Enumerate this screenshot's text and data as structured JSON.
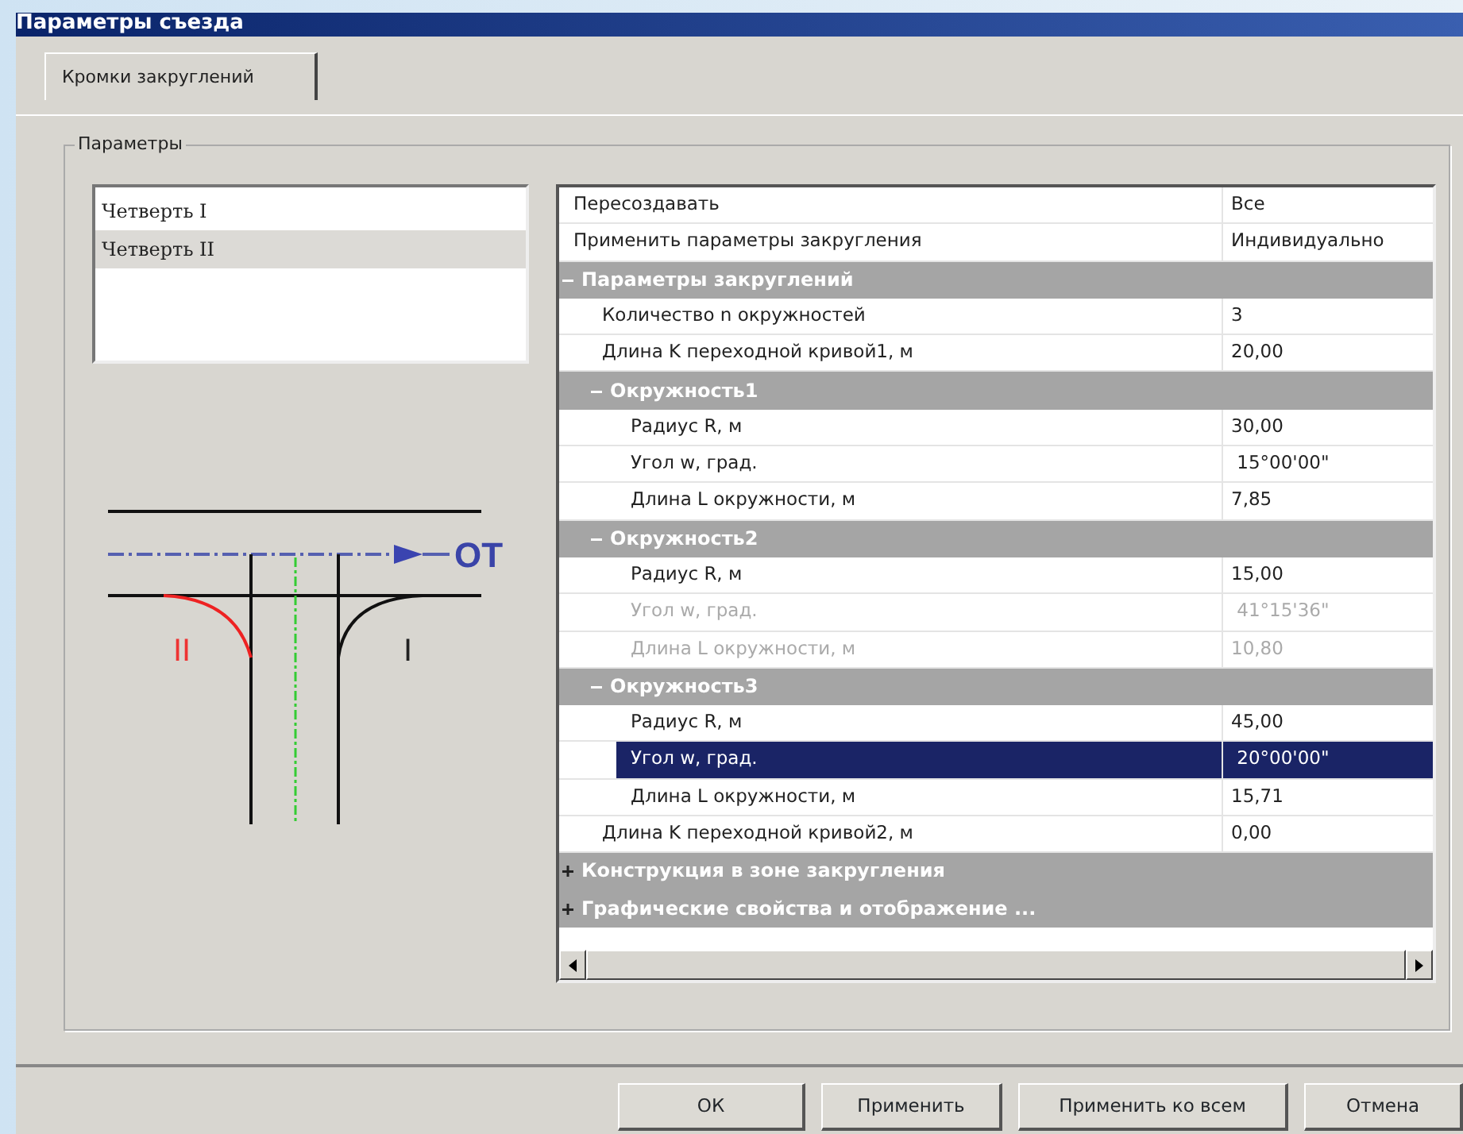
{
  "window": {
    "title": "Параметры съезда"
  },
  "tabs": [
    {
      "label": "Кромки закруглений",
      "selected": true
    }
  ],
  "group": {
    "title": "Параметры"
  },
  "quarters": [
    {
      "label": "Четверть I",
      "selected": false
    },
    {
      "label": "Четверть  II",
      "selected": true
    }
  ],
  "diagram": {
    "axis_label": "ОТ",
    "quarter_labels": [
      "II",
      "I"
    ]
  },
  "grid": [
    {
      "kind": "property",
      "name": "Пересоздавать",
      "value": "Все",
      "disabled": false,
      "selected": false
    },
    {
      "kind": "property",
      "name": "Применить параметры закругления",
      "value": "Индивидуально",
      "disabled": false,
      "selected": false
    },
    {
      "kind": "category",
      "name": "Параметры закруглений",
      "expanded": true,
      "children": [
        {
          "kind": "property",
          "name": "Количество n окружностей",
          "value": "3",
          "disabled": false,
          "selected": false
        },
        {
          "kind": "property",
          "name": "Длина K переходной кривой1, м",
          "value": "20,00",
          "disabled": false,
          "selected": false
        },
        {
          "kind": "category",
          "name": "Окружность1",
          "expanded": true,
          "children": [
            {
              "kind": "property",
              "name": "Радиус R, м",
              "value": "30,00",
              "disabled": false,
              "selected": false
            },
            {
              "kind": "property",
              "name": "Угол w, град.",
              "value": " 15°00'00\"",
              "disabled": false,
              "selected": false
            },
            {
              "kind": "property",
              "name": "Длина L окружности, м",
              "value": "7,85",
              "disabled": false,
              "selected": false
            }
          ]
        },
        {
          "kind": "category",
          "name": "Окружность2",
          "expanded": true,
          "children": [
            {
              "kind": "property",
              "name": "Радиус R, м",
              "value": "15,00",
              "disabled": false,
              "selected": false
            },
            {
              "kind": "property",
              "name": "Угол w, град.",
              "value": " 41°15'36\"",
              "disabled": true,
              "selected": false
            },
            {
              "kind": "property",
              "name": "Длина L окружности, м",
              "value": "10,80",
              "disabled": true,
              "selected": false
            }
          ]
        },
        {
          "kind": "category",
          "name": "Окружность3",
          "expanded": true,
          "children": [
            {
              "kind": "property",
              "name": "Радиус R, м",
              "value": "45,00",
              "disabled": false,
              "selected": false
            },
            {
              "kind": "property",
              "name": "Угол w, град.",
              "value": " 20°00'00\"",
              "disabled": false,
              "selected": true
            },
            {
              "kind": "property",
              "name": "Длина L окружности, м",
              "value": "15,71",
              "disabled": false,
              "selected": false
            }
          ]
        },
        {
          "kind": "property",
          "name": "Длина K переходной кривой2, м",
          "value": "0,00",
          "disabled": false,
          "selected": false
        }
      ]
    },
    {
      "kind": "category",
      "name": "Конструкция в зоне закругления",
      "expanded": false
    },
    {
      "kind": "category",
      "name": "Графические свойства  и отображение ...",
      "expanded": false
    }
  ],
  "buttons": [
    {
      "label": "ОК"
    },
    {
      "label": "Применить"
    },
    {
      "label": "Применить ко всем"
    },
    {
      "label": "Отмена"
    }
  ]
}
